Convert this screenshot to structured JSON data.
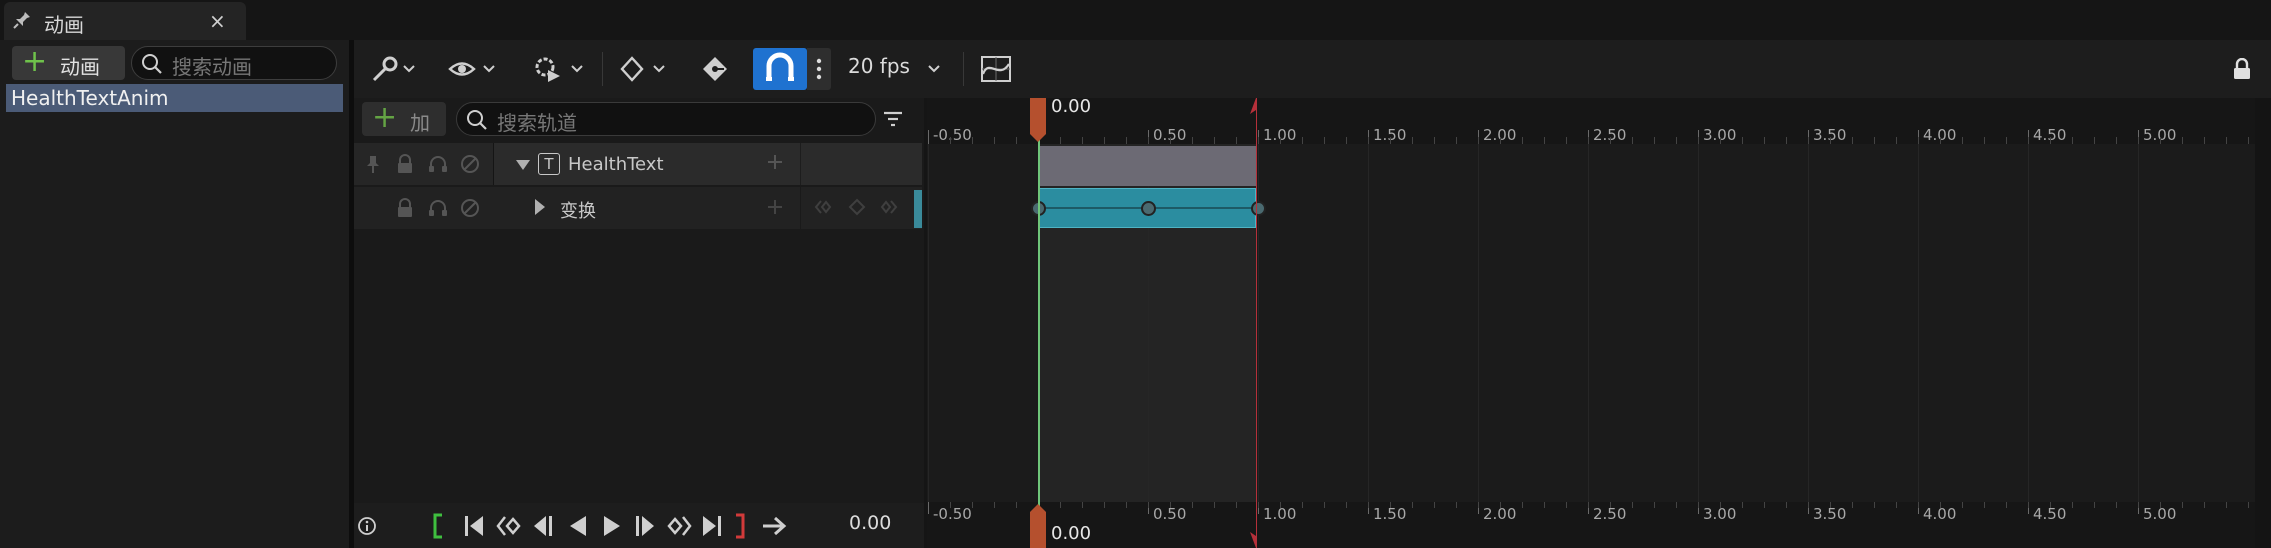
{
  "tab": {
    "title": "动画",
    "close": "×",
    "pin_icon": "pin-icon"
  },
  "left_panel": {
    "add_button": {
      "plus": "+",
      "label": "动画"
    },
    "search_placeholder": "搜索动画",
    "animations": [
      {
        "name": "HealthTextAnim",
        "selected": true
      }
    ]
  },
  "toolbar": {
    "fps": "20 fps",
    "icons": [
      "wrench-icon",
      "eye-icon",
      "render-gear-icon",
      "keyframe-icon",
      "key-filter-icon",
      "magnet-icon",
      "more-icon",
      "curve-editor-icon",
      "lock-icon"
    ],
    "snap_enabled": true
  },
  "outliner": {
    "add_track": {
      "plus": "+",
      "label": "加"
    },
    "search_placeholder": "搜索轨道",
    "tracks": [
      {
        "name": "HealthText",
        "type_icon": "T",
        "expanded": true
      },
      {
        "name": "变换",
        "expanded": false
      }
    ]
  },
  "playback": {
    "time": "0.00",
    "controls": [
      "info-icon",
      "range-start-icon",
      "jump-to-start-icon",
      "prev-key-icon",
      "step-back-icon",
      "play-reverse-icon",
      "play-icon",
      "step-forward-icon",
      "next-key-icon",
      "jump-to-end-icon",
      "range-end-icon",
      "loop-icon"
    ]
  },
  "timeline": {
    "tick_labels": [
      "-0.50",
      "0.50",
      "1.00",
      "1.50",
      "2.00",
      "2.50",
      "3.00",
      "3.50",
      "4.00",
      "4.50",
      "5.00"
    ],
    "ticks": [
      -0.5,
      0.5,
      1.0,
      1.5,
      2.0,
      2.5,
      3.0,
      3.5,
      4.0,
      4.5,
      5.0
    ],
    "playhead_label": "0.00",
    "playhead_time": 0.0,
    "end_time": 1.0,
    "section_start": 0.0,
    "section_end": 1.0,
    "keys": [
      0.0,
      0.5,
      1.0
    ],
    "colors": {
      "playhead": "#6fc57a",
      "end_marker": "#b5303a",
      "section": "#2b8da0",
      "snap": "#1f72d0"
    }
  }
}
